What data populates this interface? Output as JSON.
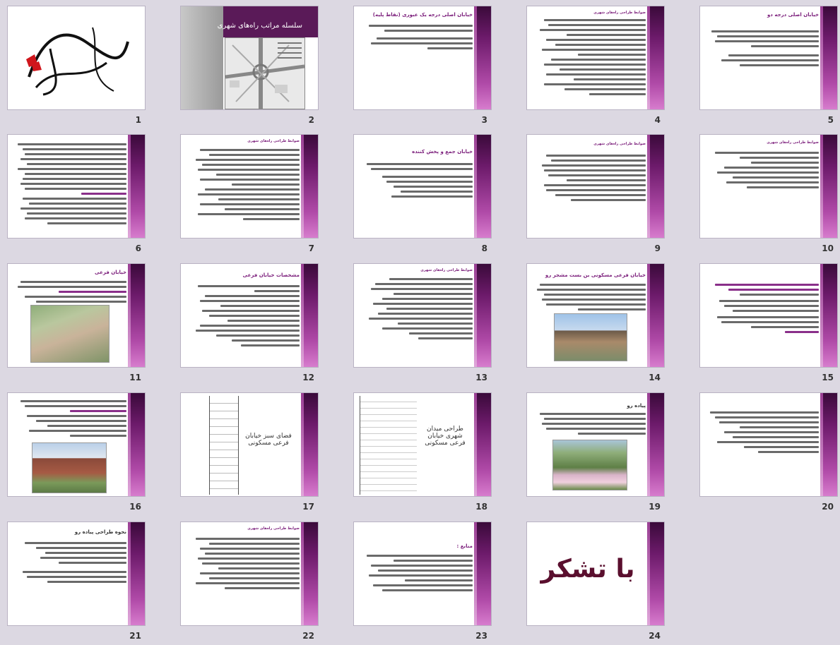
{
  "slides": [
    {
      "num": "1",
      "type": "calligraphy"
    },
    {
      "num": "2",
      "type": "cover",
      "title": "سلسله مراتب راه‌های شهری"
    },
    {
      "num": "3",
      "type": "text",
      "title": "خیابان اصلی درجه یک عبوری (نقاط پلیه)"
    },
    {
      "num": "4",
      "type": "text",
      "title": "ضوابط طراحی راه‌های شهری"
    },
    {
      "num": "5",
      "type": "text",
      "title": "خیابان اصلی درجه دو"
    },
    {
      "num": "6",
      "type": "text",
      "title": ""
    },
    {
      "num": "7",
      "type": "text",
      "title": "ضوابط طراحی راه‌های شهری"
    },
    {
      "num": "8",
      "type": "text",
      "title": "خیابان جمع و پخش کننده"
    },
    {
      "num": "9",
      "type": "text",
      "title": "ضوابط طراحی راه‌های شهری"
    },
    {
      "num": "10",
      "type": "text",
      "title": "ضوابط طراحی راه‌های شهری"
    },
    {
      "num": "11",
      "type": "photo",
      "title": "خیابان فرعی"
    },
    {
      "num": "12",
      "type": "text",
      "title": "مشخصات خیابان فرعی"
    },
    {
      "num": "13",
      "type": "text",
      "title": "ضوابط طراحی راه‌های شهری"
    },
    {
      "num": "14",
      "type": "photo",
      "title": "خیابان فرعی مسکونی بن بست مشجر رو"
    },
    {
      "num": "15",
      "type": "text",
      "title": ""
    },
    {
      "num": "16",
      "type": "photo",
      "title": ""
    },
    {
      "num": "17",
      "type": "drawing",
      "title": "فضای سبز خیابان فرعی مسکونی"
    },
    {
      "num": "18",
      "type": "drawing",
      "title": "طراحی میدان شهری خیابان فرعی مسکونی"
    },
    {
      "num": "19",
      "type": "photo",
      "title": "پیاده رو"
    },
    {
      "num": "20",
      "type": "text",
      "title": ""
    },
    {
      "num": "21",
      "type": "text",
      "title": "نحوه طراحی پیاده رو"
    },
    {
      "num": "22",
      "type": "text",
      "title": "ضوابط طراحی راه‌های شهری"
    },
    {
      "num": "23",
      "type": "text",
      "title": "منابع :"
    },
    {
      "num": "24",
      "type": "thanks",
      "title": "با تشکر"
    }
  ],
  "colors": {
    "accent": "#7a1c7a",
    "bar_dark": "#3a0a3a",
    "bar_light": "#d77ccd",
    "background": "#dcd8e2"
  }
}
